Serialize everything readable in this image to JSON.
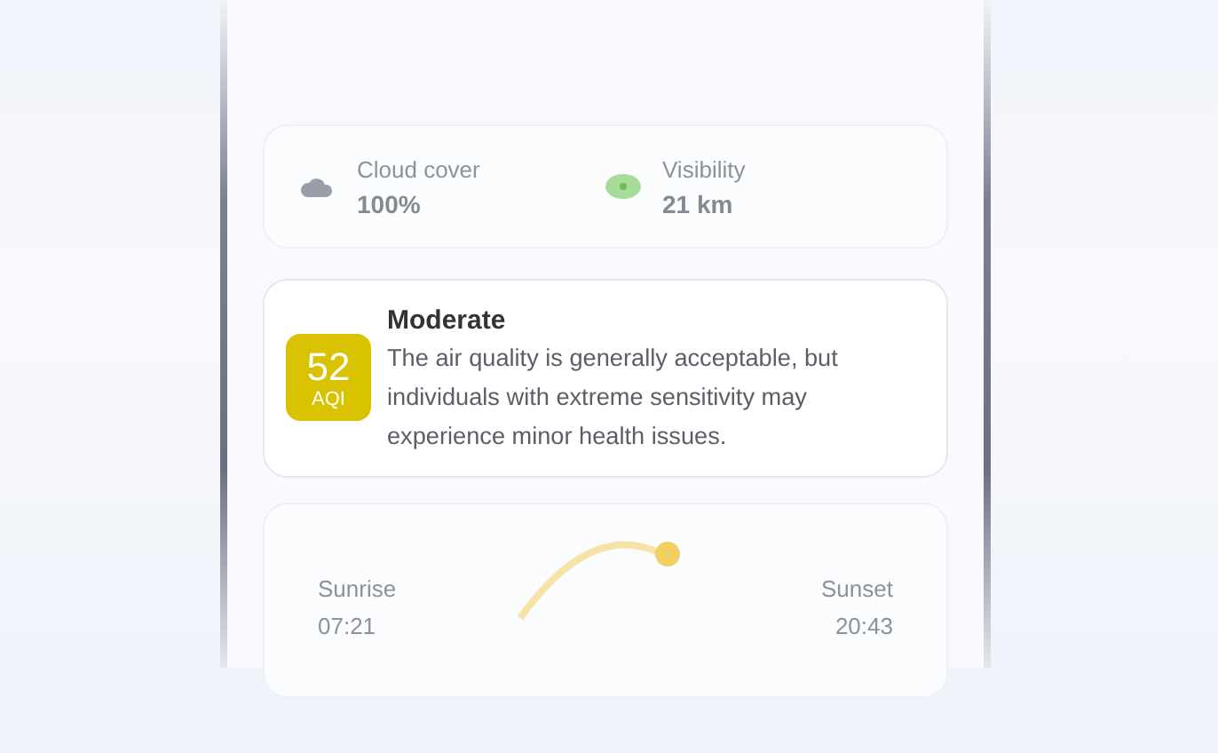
{
  "stats": [
    {
      "kind": "cloud",
      "label": "Cloud cover",
      "value": "100%"
    },
    {
      "kind": "eye",
      "label": "Visibility",
      "value": "21 km"
    }
  ],
  "aqi": {
    "value": "52",
    "unit": "AQI",
    "category": "Moderate",
    "description": "The air quality is generally acceptable, but individuals with extreme sensitivity may experience minor health issues.",
    "color": "#d9c200"
  },
  "sun": {
    "sunrise_label": "Sunrise",
    "sunrise": "07:21",
    "sunset_label": "Sunset",
    "sunset": "20:43"
  }
}
